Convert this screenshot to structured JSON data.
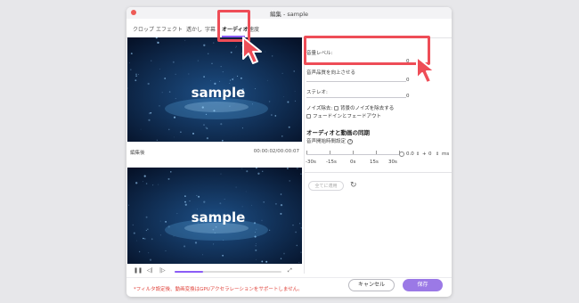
{
  "window": {
    "title": "編集 - sample"
  },
  "tabs": [
    "クロップ",
    "エフェクト",
    "透かし",
    "字幕",
    "オーディオ",
    "速度"
  ],
  "video": {
    "overlay_text": "sample",
    "preview_label": "編集後",
    "time": "00:00:02/00:00:07"
  },
  "player": {
    "progress": 0.27,
    "play_icon": "pause-icon",
    "prev_icon": "prev-icon",
    "next_icon": "next-icon",
    "fullscreen_icon": "fullscreen-icon"
  },
  "audio": {
    "volume_label": "音量レベル:",
    "volume_value": "0",
    "voice_label": "音声品質を向上させる",
    "voice_value": "0",
    "stereo_label": "ステレオ:",
    "stereo_value": "0",
    "noise_label": "ノイズ除去:",
    "noise_option": "背景のノイズを除去する",
    "fade_option": "フェードインとフェードアウト"
  },
  "sync": {
    "title": "オーディオと動画の同期",
    "label": "音声開始時間設定",
    "value_left": "0.0",
    "value_right": "0",
    "unit": "ms",
    "tick_labels": [
      "-30s",
      "-15s",
      "0s",
      "15s",
      "30s"
    ]
  },
  "actions": {
    "apply_all": "全てに適用",
    "cancel": "キャンセル",
    "save": "保存"
  },
  "footer": {
    "note": "*フィルタ設定後、動画変換はGPUアクセラレーションをサポートしません。"
  },
  "colors": {
    "accent": "#8b5cf6",
    "save_button": "#9b79e6",
    "highlight": "#ee4d57",
    "warning_text": "#e0433b"
  }
}
